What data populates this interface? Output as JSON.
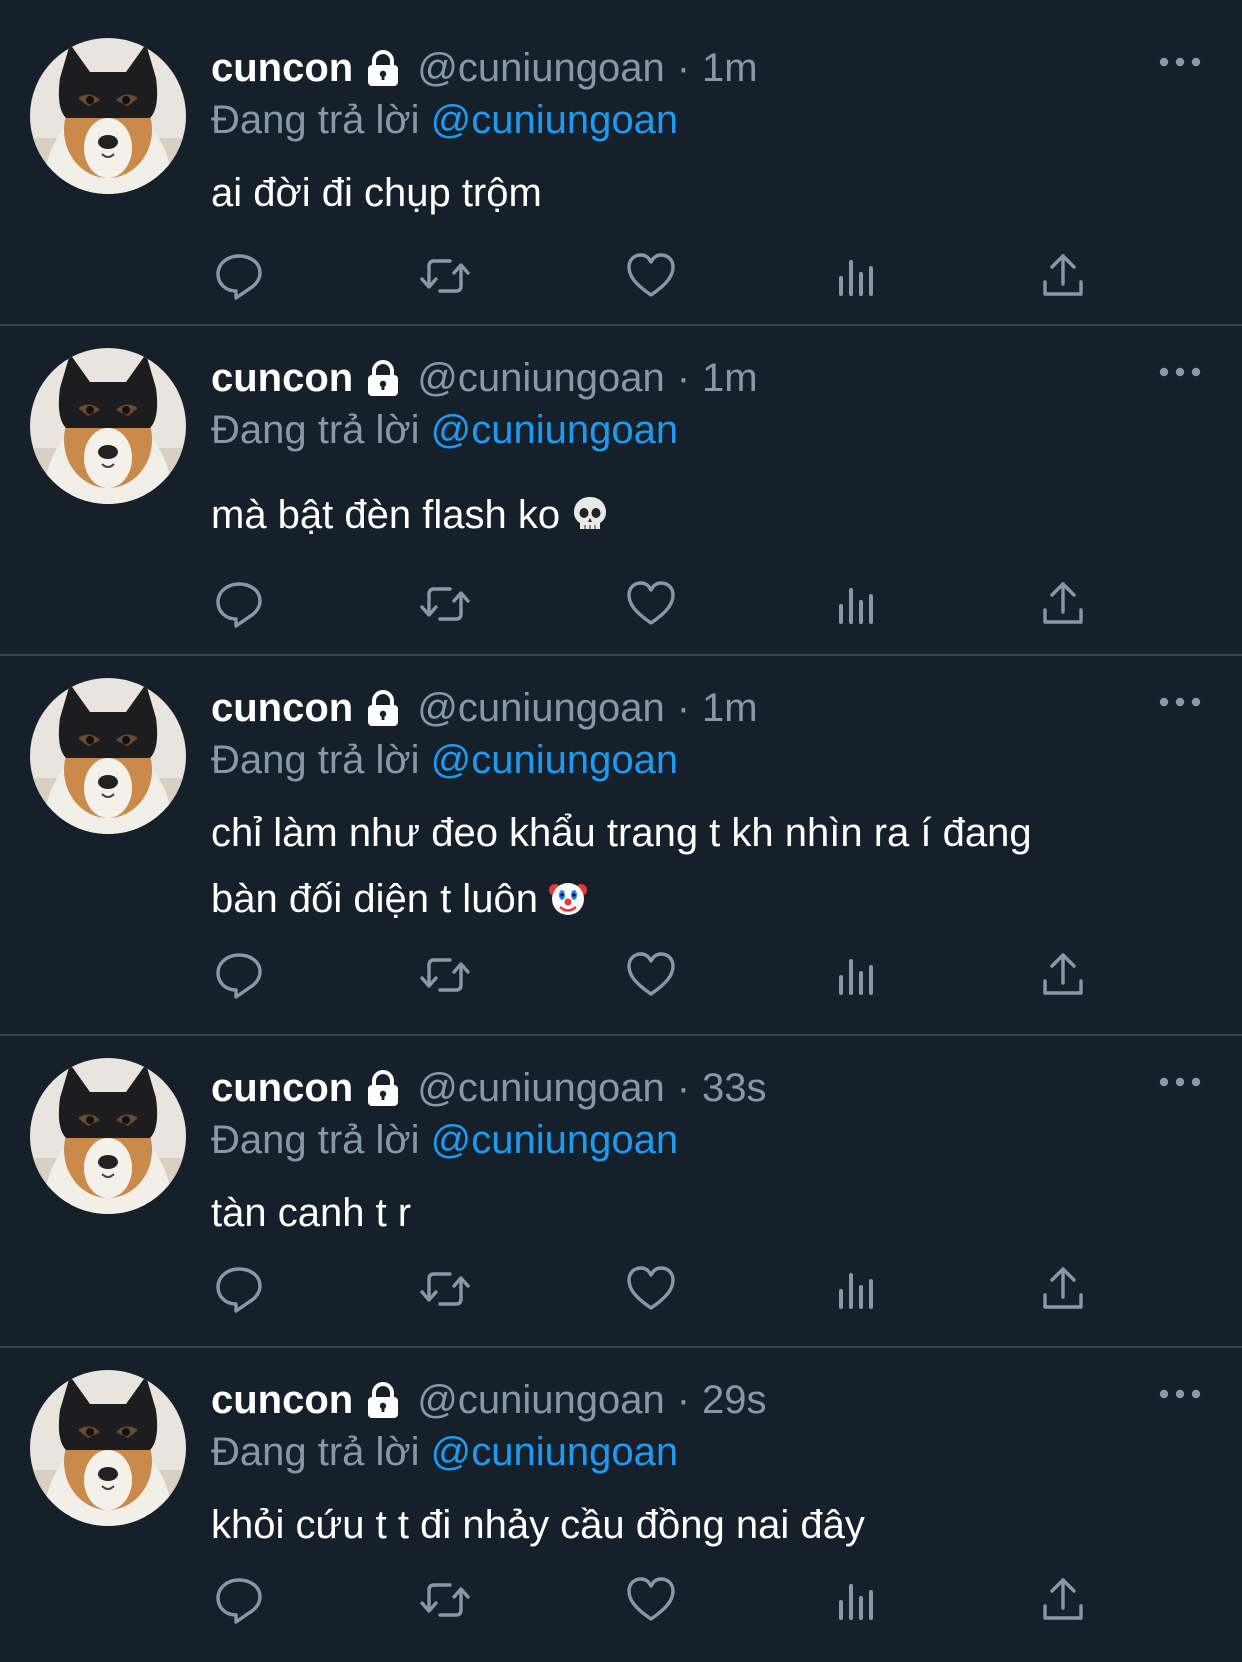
{
  "colors": {
    "background": "#15202b",
    "divider": "#38444d",
    "secondary_text": "#8899a6",
    "link": "#1d9bf0"
  },
  "tweets": [
    {
      "name": "cuncon",
      "handle": "@cuniungoan",
      "separator": "·",
      "time": "1m",
      "reply_prefix": "Đang trả lời",
      "reply_to": "@cuniungoan",
      "text": "ai đời đi chụp trộm",
      "emoji": ""
    },
    {
      "name": "cuncon",
      "handle": "@cuniungoan",
      "separator": "·",
      "time": "1m",
      "reply_prefix": "Đang trả lời",
      "reply_to": "@cuniungoan",
      "text": "mà bật đèn flash ko",
      "emoji": "skull"
    },
    {
      "name": "cuncon",
      "handle": "@cuniungoan",
      "separator": "·",
      "time": "1m",
      "reply_prefix": "Đang trả lời",
      "reply_to": "@cuniungoan",
      "text": "chỉ làm như đeo khẩu trang t kh nhìn ra í đang\nbàn đối diện t luôn",
      "emoji": "clown"
    },
    {
      "name": "cuncon",
      "handle": "@cuniungoan",
      "separator": "·",
      "time": "33s",
      "reply_prefix": "Đang trả lời",
      "reply_to": "@cuniungoan",
      "text": "tàn canh t r",
      "emoji": ""
    },
    {
      "name": "cuncon",
      "handle": "@cuniungoan",
      "separator": "·",
      "time": "29s",
      "reply_prefix": "Đang trả lời",
      "reply_to": "@cuniungoan",
      "text": "khỏi cứu t t đi nhảy cầu đồng nai đây",
      "emoji": ""
    }
  ],
  "icons": {
    "lock": "lock-icon",
    "more": "more-icon",
    "reply": "reply-icon",
    "retweet": "retweet-icon",
    "like": "heart-icon",
    "views": "views-icon",
    "share": "share-icon"
  }
}
